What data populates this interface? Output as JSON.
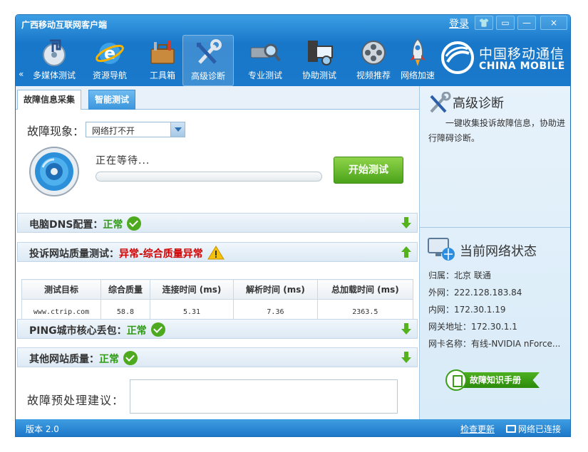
{
  "titlebar": {
    "title": "广西移动互联网客户端",
    "login": "登录",
    "buttons": {
      "skin": "👕",
      "menu": "▭",
      "minimize": "—",
      "close": "×"
    }
  },
  "toolbar": {
    "nav_arrow": "«",
    "items": [
      {
        "label": "多媒体测试",
        "icon": "music-disc-icon"
      },
      {
        "label": "资源导航",
        "icon": "browser-e-icon"
      },
      {
        "label": "工具箱",
        "icon": "toolbox-icon"
      },
      {
        "label": "高级诊断",
        "icon": "wrench-screwdriver-icon",
        "active": true
      },
      {
        "label": "专业测试",
        "icon": "magnifier-device-icon"
      },
      {
        "label": "协助测试",
        "icon": "computer-assist-icon"
      },
      {
        "label": "视频推荐",
        "icon": "film-reel-icon"
      },
      {
        "label": "网络加速",
        "icon": "rocket-icon"
      }
    ],
    "brand_cn": "中国移动通信",
    "brand_en": "CHINA MOBILE"
  },
  "tabs": {
    "active": "故障信息采集",
    "inactive": "智能测试"
  },
  "diagnosis": {
    "symptom_label": "故障现象：",
    "symptom_value": "网络打不开",
    "status": "正在等待...",
    "start_button": "开始测试"
  },
  "sections": {
    "dns": {
      "label": "电脑DNS配置：",
      "status": "正常"
    },
    "complaint": {
      "label": "投诉网站质量测试：",
      "status": "异常-综合质量异常"
    },
    "ping": {
      "label": "PING城市核心丢包：",
      "status": "正常"
    },
    "other": {
      "label": "其他网站质量：",
      "status": "正常"
    }
  },
  "table": {
    "headers": [
      "测试目标",
      "综合质量",
      "连接时间 (ms)",
      "解析时间 (ms)",
      "总加载时间 (ms)"
    ],
    "rows": [
      [
        "www.ctrip.com",
        "58.8",
        "5.31",
        "7.36",
        "2363.5"
      ]
    ]
  },
  "advice": {
    "label": "故障预处理建议：",
    "value": ""
  },
  "right_panel": {
    "advanced_title": "高级诊断",
    "advanced_desc": "一键收集投诉故障信息，协助进行障碍诊断。",
    "network_title": "当前网络状态",
    "info": {
      "location": "归属：北京 联通",
      "wan": "外网：222.128.183.84",
      "lan": "内网：172.30.1.19",
      "gateway": "网关地址：172.30.1.1",
      "nic": "网卡名称：有线-NVIDIA nForce..."
    },
    "manual_button": "故障知识手册"
  },
  "statusbar": {
    "version": "版本 2.0",
    "update": "检查更新",
    "connection": "网络已连接"
  },
  "colors": {
    "title_blue": "#1a79cb",
    "ok_green": "#2f9a14",
    "error_red": "#d30000",
    "button_green": "#4aa31a"
  }
}
